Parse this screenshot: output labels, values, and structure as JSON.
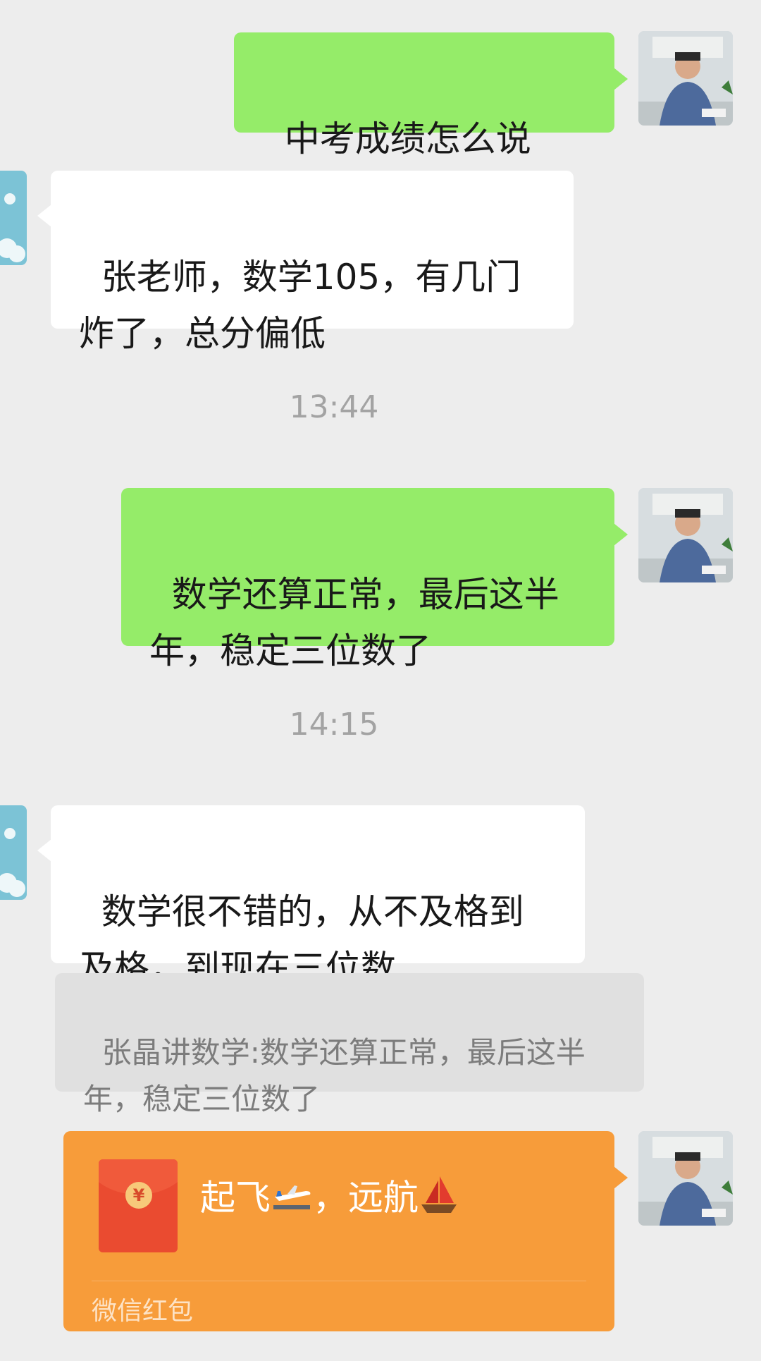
{
  "messages": [
    {
      "from": "me",
      "text": "中考成绩怎么说"
    },
    {
      "from": "other",
      "text": "张老师，数学105，有几门\n炸了，总分偏低"
    },
    {
      "timestamp": "13:44"
    },
    {
      "from": "me",
      "text": "数学还算正常，最后这半\n年，稳定三位数了"
    },
    {
      "timestamp": "14:15"
    },
    {
      "from": "other",
      "text": "数学很不错的，从不及格到\n及格，到现在三位数"
    },
    {
      "quote": "张晶讲数学:数学还算正常，最后这半\n年，稳定三位数了"
    },
    {
      "from": "me",
      "type": "red-packet",
      "text": "起飞",
      "text2": "，远航",
      "footer": "微信红包"
    }
  ],
  "icons": {
    "emoji1": "peek-face-icon",
    "plane": "airplane-icon",
    "boat": "sailboat-icon",
    "envelope": "red-envelope-icon"
  },
  "colors": {
    "background": "#ededed",
    "my_bubble": "#95ec69",
    "other_bubble": "#ffffff",
    "red_packet": "#f79c3a"
  }
}
